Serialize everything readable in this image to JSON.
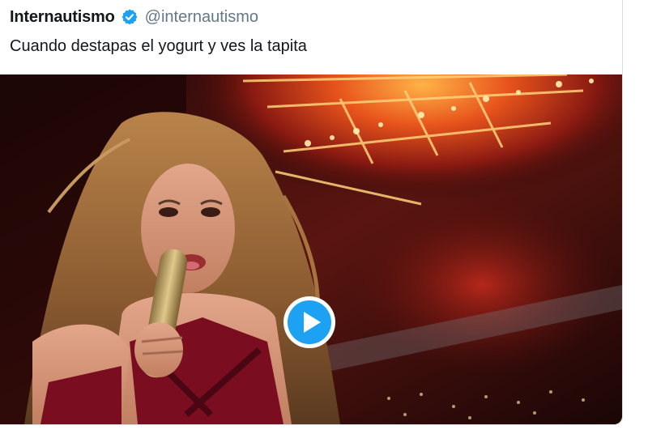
{
  "tweet": {
    "display_name": "Internautismo",
    "handle": "@internautismo",
    "text": "Cuando destapas el yogurt y ves la tapita",
    "verified": true
  },
  "media": {
    "type": "video",
    "play_icon": "play-icon"
  },
  "colors": {
    "accent": "#1da1f2",
    "name_text": "#14171a",
    "handle_text": "#657786"
  }
}
